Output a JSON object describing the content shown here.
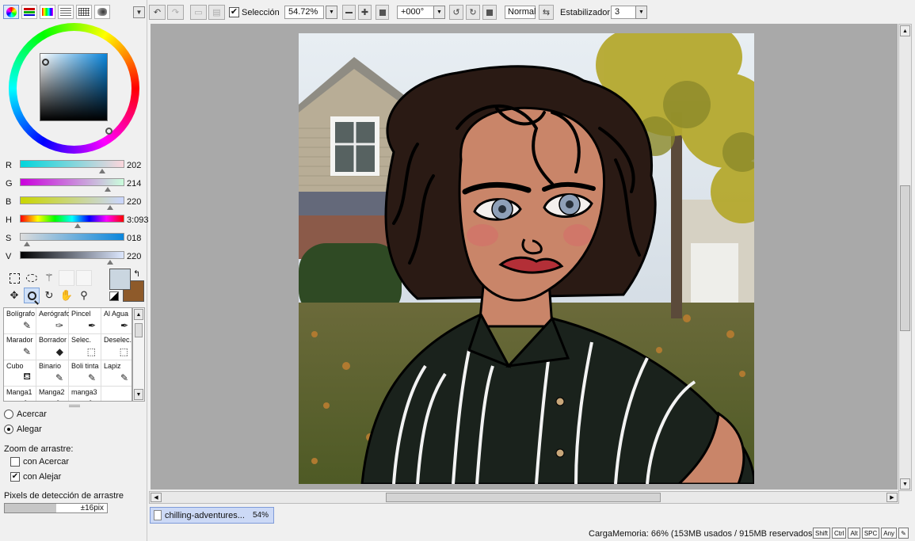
{
  "left_panel": {
    "sliders": [
      {
        "label": "R",
        "value": "202",
        "fraction": 0.79,
        "gradient": "linear-gradient(to right, #00d6dc, #fcd6dc)"
      },
      {
        "label": "G",
        "value": "214",
        "fraction": 0.84,
        "gradient": "linear-gradient(to right, #ca00dc, #cafedc)"
      },
      {
        "label": "B",
        "value": "220",
        "fraction": 0.86,
        "gradient": "linear-gradient(to right, #cad600, #cad6ff)"
      },
      {
        "label": "H",
        "value": "3:093",
        "fraction": 0.55,
        "gradient": "linear-gradient(to right, #ff0000, #ffff00, #00ff00, #00ffff, #0000ff, #ff00ff, #ff0000)"
      },
      {
        "label": "S",
        "value": "018",
        "fraction": 0.07,
        "gradient": "linear-gradient(to right, #dcdcdc, #0a86dc)"
      },
      {
        "label": "V",
        "value": "220",
        "fraction": 0.86,
        "gradient": "linear-gradient(to right, #000000, #dce7ff)"
      }
    ],
    "colors": {
      "foreground": "#cad6e0",
      "background": "#8e5a2a"
    },
    "brushes": [
      {
        "label": "Bolígrafo",
        "icon": "pen-icon",
        "glyph": "✎"
      },
      {
        "label": "Aerógrafo",
        "icon": "airbrush-icon",
        "glyph": "✑"
      },
      {
        "label": "Pincel",
        "icon": "brush-icon",
        "glyph": "✒"
      },
      {
        "label": "Al Agua",
        "icon": "watercolor-icon",
        "glyph": "✒"
      },
      {
        "label": "Marador",
        "icon": "marker-icon",
        "glyph": "✎"
      },
      {
        "label": "Borrador",
        "icon": "eraser-icon",
        "glyph": "◆"
      },
      {
        "label": "Selec.",
        "icon": "select-pen-icon",
        "glyph": "⬚"
      },
      {
        "label": "Deselec.",
        "icon": "deselect-pen-icon",
        "glyph": "⬚"
      },
      {
        "label": "Cubo",
        "icon": "bucket-icon",
        "glyph": "⛾"
      },
      {
        "label": "Binario",
        "icon": "binary-pen-icon",
        "glyph": "✎"
      },
      {
        "label": "Boli tinta",
        "icon": "ink-pen-icon",
        "glyph": "✎"
      },
      {
        "label": "Lapiz",
        "icon": "pencil-icon",
        "glyph": "✎"
      },
      {
        "label": "Manga1",
        "icon": "manga1-icon",
        "glyph": "✎"
      },
      {
        "label": "Manga2",
        "icon": "manga2-icon",
        "glyph": "✎"
      },
      {
        "label": "manga3",
        "icon": "manga3-icon",
        "glyph": "✎"
      }
    ],
    "zoom_in_label": "Acercar",
    "zoom_out_label": "Alegar",
    "drag_zoom_label": "Zoom de arrastre:",
    "drag_zoom_in_label": "con Acercar",
    "drag_zoom_out_label": "con Alejar",
    "drag_zoom_in_checked": false,
    "drag_zoom_out_checked": true,
    "pixel_detect_label": "Pixels de detección de arrastre",
    "pixel_detect_value": "±16pix",
    "pixel_detect_fraction": 0.5
  },
  "toolbar": {
    "selection_label": "Selección",
    "selection_checked": true,
    "zoom_value": "54.72%",
    "rotation_value": "+000°",
    "blend_mode": "Normal",
    "stabilizer_label": "Estabilizador",
    "stabilizer_value": "3"
  },
  "document": {
    "tab_name": "chilling-adventures...",
    "tab_zoom": "54%"
  },
  "status": {
    "memory_text": "CargaMemoria: 66% (153MB usados / 915MB reservados)",
    "keys": [
      "Shift",
      "Ctrl",
      "Alt",
      "SPC",
      "Any"
    ]
  }
}
